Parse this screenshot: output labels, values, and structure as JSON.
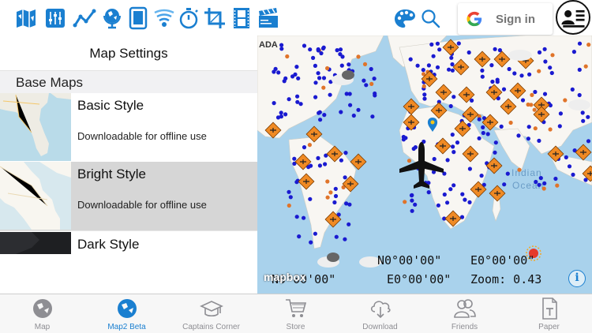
{
  "toolbar": {
    "icons": [
      "map-icon",
      "sliders-icon",
      "route-icon",
      "globe-icon",
      "tablet-icon",
      "wifi-signal-icon",
      "stopwatch-icon",
      "crop-icon",
      "film-icon",
      "clapperboard-icon",
      "palette-icon",
      "search-icon"
    ],
    "signin_label": "Sign in",
    "accent": "#1a7fd0"
  },
  "settings": {
    "title": "Map Settings",
    "section": "Base Maps",
    "styles": [
      {
        "name": "Basic Style",
        "desc": "Downloadable for offline use",
        "selected": false
      },
      {
        "name": "Bright Style",
        "desc": "Downloadable for offline use",
        "selected": true
      },
      {
        "name": "Dark Style",
        "desc": "",
        "selected": false
      }
    ]
  },
  "map": {
    "label_ada": "ADA",
    "ocean_label_1": "Indian",
    "ocean_label_2": "Ocean",
    "coord_top_lat": "N0°00'00\"",
    "coord_top_lon": "E0°00'00\"",
    "coord_bottom_lat": "N0°00'00\"",
    "coord_bottom_lon": "E0°00'00\"",
    "zoom_text": "Zoom: 0.43",
    "attribution": "mapbox",
    "info": "i"
  },
  "tabs": [
    {
      "label": "Map",
      "icon": "globe-icon",
      "active": false
    },
    {
      "label": "Map2 Beta",
      "icon": "globe-icon",
      "active": true
    },
    {
      "label": "Captains Corner",
      "icon": "graduation-cap-icon",
      "active": false
    },
    {
      "label": "Store",
      "icon": "cart-icon",
      "active": false
    },
    {
      "label": "Download",
      "icon": "cloud-download-icon",
      "active": false
    },
    {
      "label": "Friends",
      "icon": "friends-icon",
      "active": false
    },
    {
      "label": "Paper",
      "icon": "paper-icon",
      "active": false
    }
  ]
}
